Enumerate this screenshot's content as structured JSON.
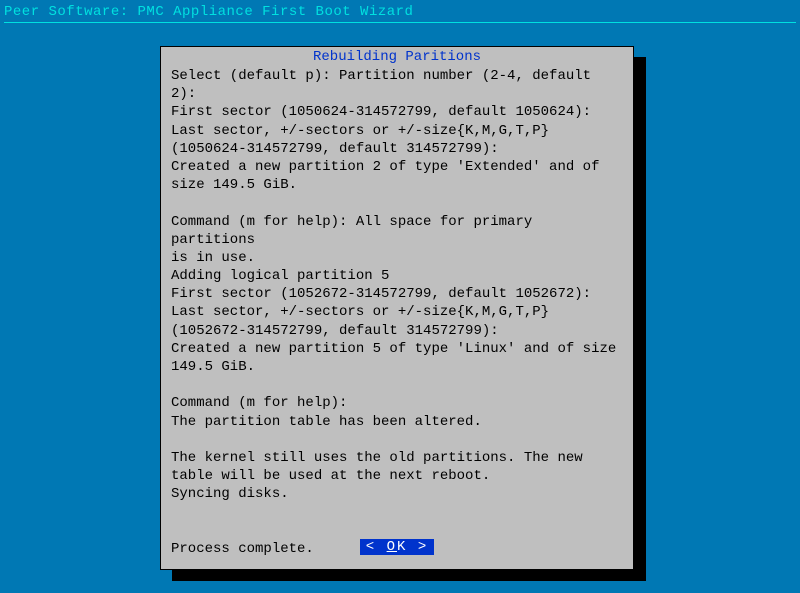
{
  "header": {
    "title": "Peer Software: PMC Appliance First Boot Wizard"
  },
  "dialog": {
    "title": "Rebuilding Paritions",
    "body": "Select (default p): Partition number (2-4, default 2):\nFirst sector (1050624-314572799, default 1050624):\nLast sector, +/-sectors or +/-size{K,M,G,T,P}\n(1050624-314572799, default 314572799):\nCreated a new partition 2 of type 'Extended' and of\nsize 149.5 GiB.\n\nCommand (m for help): All space for primary partitions\nis in use.\nAdding logical partition 5\nFirst sector (1052672-314572799, default 1052672):\nLast sector, +/-sectors or +/-size{K,M,G,T,P}\n(1052672-314572799, default 314572799):\nCreated a new partition 5 of type 'Linux' and of size\n149.5 GiB.\n\nCommand (m for help):\nThe partition table has been altered.\n\nThe kernel still uses the old partitions. The new\ntable will be used at the next reboot.\nSyncing disks.\n\n\nProcess complete.",
    "buttons": {
      "ok_left": "< ",
      "ok_char": "O",
      "ok_rest": "K ",
      "ok_right": " >"
    }
  }
}
